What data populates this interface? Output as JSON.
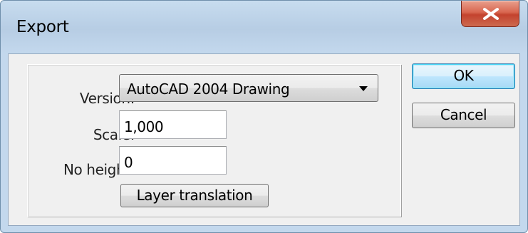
{
  "window": {
    "title": "Export",
    "close_icon": "close-x-icon"
  },
  "form": {
    "version_label": "Version:",
    "version_value": "AutoCAD 2004 Drawing",
    "scale_label": "Scale:",
    "scale_value": "1,000",
    "noheight_label": "No height:",
    "noheight_value": "0",
    "layer_translation_label": "Layer translation"
  },
  "buttons": {
    "ok_label": "OK",
    "cancel_label": "Cancel"
  },
  "colors": {
    "close_red": "#c3432e",
    "default_button_blue": "#3c7fb1",
    "frame_blue": "#b7cde4"
  }
}
